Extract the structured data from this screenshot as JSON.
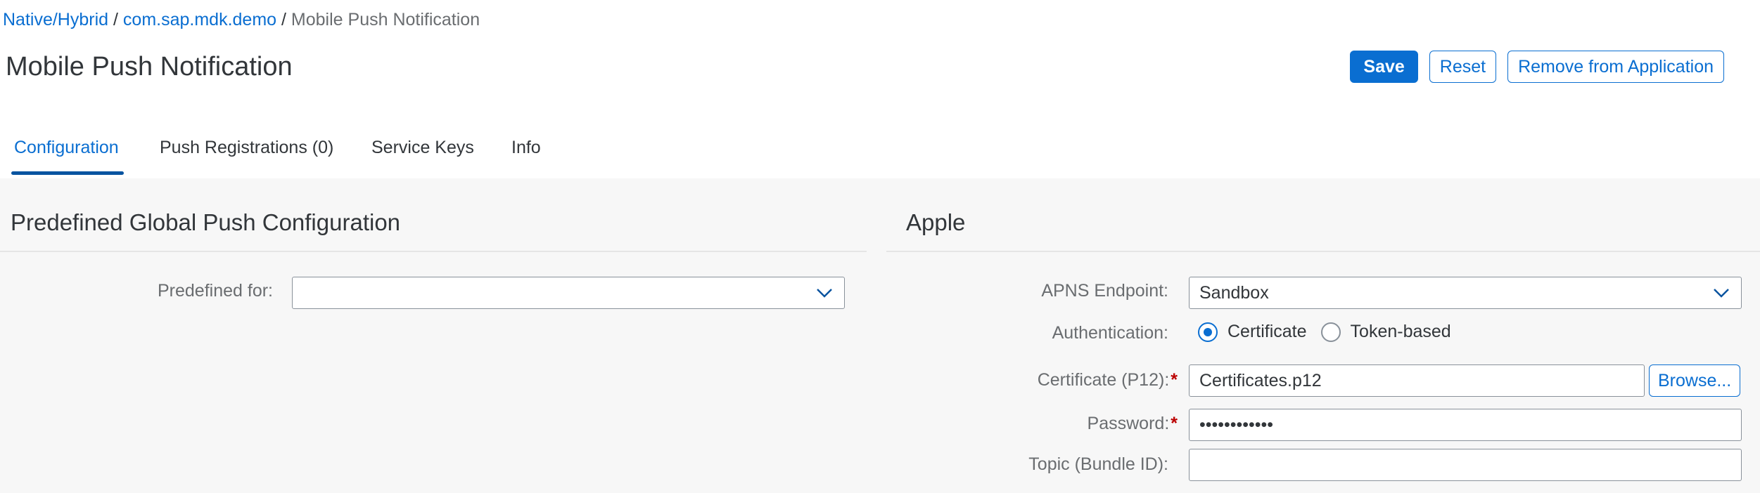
{
  "breadcrumb": {
    "items": [
      "Native/Hybrid",
      "com.sap.mdk.demo"
    ],
    "separator": "/",
    "current": "Mobile Push Notification"
  },
  "page": {
    "title": "Mobile Push Notification"
  },
  "actions": {
    "save": "Save",
    "reset": "Reset",
    "remove": "Remove from Application"
  },
  "tabs": [
    {
      "label": "Configuration",
      "active": true
    },
    {
      "label": "Push Registrations (0)",
      "active": false
    },
    {
      "label": "Service Keys",
      "active": false
    },
    {
      "label": "Info",
      "active": false
    }
  ],
  "global_config": {
    "title": "Predefined Global Push Configuration",
    "predefined_for": {
      "label": "Predefined for:",
      "value": ""
    }
  },
  "apple": {
    "title": "Apple",
    "apns_endpoint": {
      "label": "APNS Endpoint:",
      "value": "Sandbox"
    },
    "authentication": {
      "label": "Authentication:",
      "options": [
        "Certificate",
        "Token-based"
      ],
      "selected": "Certificate"
    },
    "certificate": {
      "label": "Certificate (P12):",
      "required_mark": "*",
      "value": "Certificates.p12",
      "browse": "Browse..."
    },
    "password": {
      "label": "Password:",
      "required_mark": "*",
      "value": "••••••••••••"
    },
    "topic": {
      "label": "Topic (Bundle ID):",
      "value": ""
    }
  },
  "colors": {
    "accent": "#0a6ed1",
    "tab_underline": "#0854a0",
    "required": "#bb0000",
    "content_bg": "#f7f7f7"
  },
  "icons": {
    "dropdown": "chevron-down-icon",
    "radio_selected": "radio-selected-icon",
    "radio_unselected": "radio-unselected-icon"
  }
}
